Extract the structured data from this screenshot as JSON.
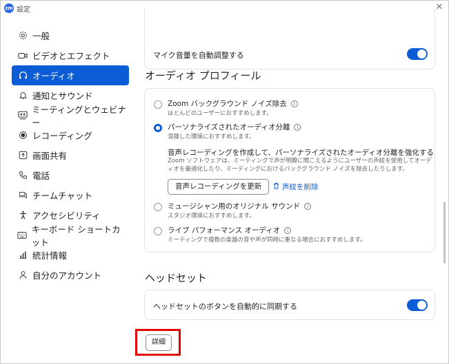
{
  "window": {
    "title": "設定",
    "logo_text": "zm"
  },
  "sidebar": {
    "items": [
      {
        "label": "一般",
        "icon": "gear-icon"
      },
      {
        "label": "ビデオとエフェクト",
        "icon": "video-camera-icon"
      },
      {
        "label": "オーディオ",
        "icon": "headphones-icon",
        "active": true
      },
      {
        "label": "通知とサウンド",
        "icon": "bell-icon"
      },
      {
        "label": "ミーティングとウェビナー",
        "icon": "meeting-icon"
      },
      {
        "label": "レコーディング",
        "icon": "record-icon"
      },
      {
        "label": "画面共有",
        "icon": "screen-share-icon"
      },
      {
        "label": "電話",
        "icon": "phone-icon"
      },
      {
        "label": "チームチャット",
        "icon": "chat-icon"
      },
      {
        "label": "アクセシビリティ",
        "icon": "accessibility-icon"
      },
      {
        "label": "キーボード ショートカット",
        "icon": "keyboard-icon"
      },
      {
        "label": "統計情報",
        "icon": "statistics-icon"
      },
      {
        "label": "自分のアカウント",
        "icon": "account-icon"
      }
    ]
  },
  "audio": {
    "auto_adjust_label": "マイク音量を自動調整する",
    "auto_adjust_on": true,
    "profile_heading": "オーディオ プロフィール",
    "options": [
      {
        "title": "Zoom バックグラウンド ノイズ除去",
        "sub": "ほとんどのユーザーにおすすめします。",
        "selected": false
      },
      {
        "title": "パーソナライズされたオーディオ分離",
        "sub": "混雑した環境におすすめします。",
        "selected": true
      },
      {
        "title": "ミュージシャン用のオリジナル サウンド",
        "sub": "スタジオ環境におすすめします。",
        "selected": false
      },
      {
        "title": "ライブ パフォーマンス オーディオ",
        "sub": "ミーティングで複数の楽器の音や声が同時に重なる場合におすすめします。",
        "selected": false
      }
    ],
    "voice_heading": "音声レコーディングを作成して、パーソナライズされたオーディオ分離を強化する",
    "voice_desc": "Zoom ソフトウェアは、ミーティングで声が明瞭に聞こえるようにユーザーの声紋を使用してオーディオを最適化したり、ミーティングにおけるバックグラウンド ノイズを除去したりします。",
    "update_button": "音声レコーディングを更新",
    "delete_link": "声紋を削除",
    "headset_heading": "ヘッドセット",
    "headset_sync_label": "ヘッドセットのボタンを自動的に同期する",
    "headset_sync_on": true,
    "detail_button": "詳細"
  },
  "colors": {
    "accent": "#0b5cd5",
    "highlight": "#e10000"
  }
}
